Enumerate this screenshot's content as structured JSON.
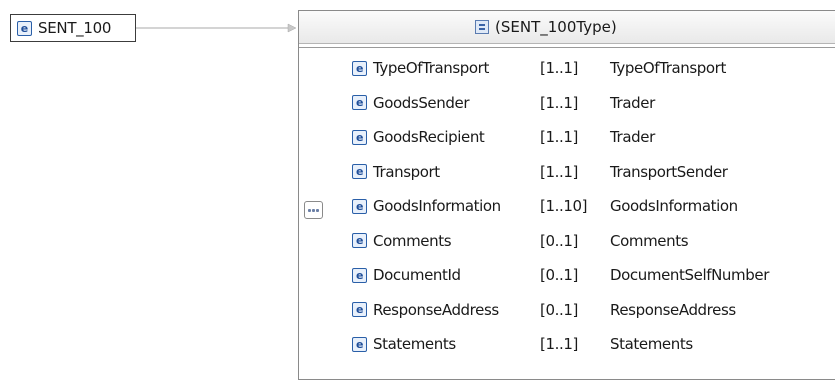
{
  "root": {
    "icon": "element-icon",
    "icon_letter": "e",
    "label": "SENT_100"
  },
  "type_header": {
    "icon": "complex-type-icon",
    "label": "(SENT_100Type)"
  },
  "compositor": {
    "icon": "sequence-icon"
  },
  "children": [
    {
      "name": "TypeOfTransport",
      "cardinality": "[1..1]",
      "type": "TypeOfTransport"
    },
    {
      "name": "GoodsSender",
      "cardinality": "[1..1]",
      "type": "Trader"
    },
    {
      "name": "GoodsRecipient",
      "cardinality": "[1..1]",
      "type": "Trader"
    },
    {
      "name": "Transport",
      "cardinality": "[1..1]",
      "type": "TransportSender"
    },
    {
      "name": "GoodsInformation",
      "cardinality": "[1..10]",
      "type": "GoodsInformation"
    },
    {
      "name": "Comments",
      "cardinality": "[0..1]",
      "type": "Comments"
    },
    {
      "name": "DocumentId",
      "cardinality": "[0..1]",
      "type": "DocumentSelfNumber"
    },
    {
      "name": "ResponseAddress",
      "cardinality": "[0..1]",
      "type": "ResponseAddress"
    },
    {
      "name": "Statements",
      "cardinality": "[1..1]",
      "type": "Statements"
    }
  ],
  "colors": {
    "element_icon": "#2a5fa8",
    "connector": "#a8a8a8",
    "border": "#3c3c3c"
  }
}
